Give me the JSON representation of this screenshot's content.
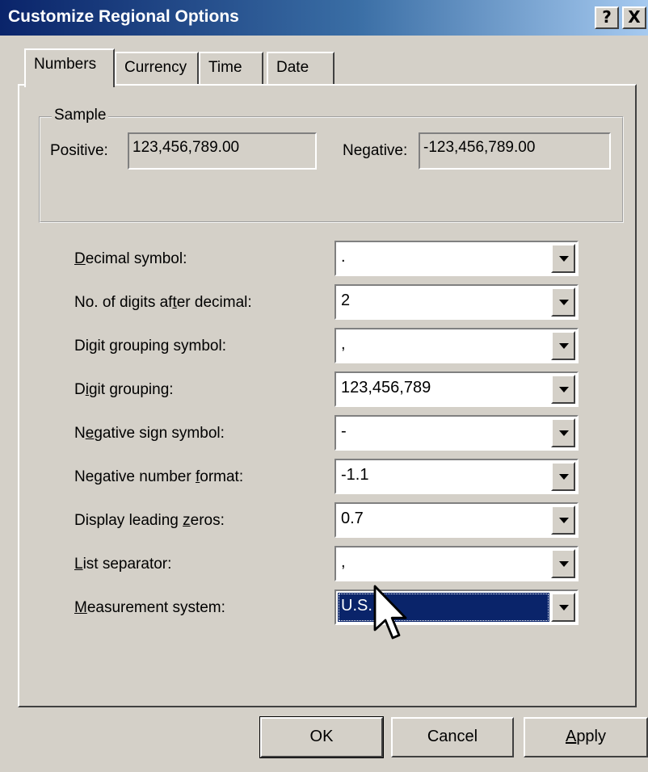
{
  "window": {
    "title": "Customize Regional Options",
    "help_button": "?",
    "close_button": "X"
  },
  "tabs": [
    {
      "label": "Numbers",
      "active": true
    },
    {
      "label": "Currency",
      "active": false
    },
    {
      "label": "Time",
      "active": false
    },
    {
      "label": "Date",
      "active": false
    }
  ],
  "sample": {
    "group_label": "Sample",
    "positive_label": "Positive:",
    "positive_value": "123,456,789.00",
    "negative_label": "Negative:",
    "negative_value": "-123,456,789.00"
  },
  "settings": [
    {
      "label": "Decimal symbol:",
      "value": "."
    },
    {
      "label": "No. of digits after decimal:",
      "value": "2"
    },
    {
      "label": "Digit grouping symbol:",
      "value": ","
    },
    {
      "label": "Digit grouping:",
      "value": "123,456,789"
    },
    {
      "label": "Negative sign symbol:",
      "value": "-"
    },
    {
      "label": "Negative number format:",
      "value": "-1.1"
    },
    {
      "label": "Display leading zeros:",
      "value": "0.7"
    },
    {
      "label": "List separator:",
      "value": ","
    },
    {
      "label": "Measurement system:",
      "value": "U.S."
    }
  ],
  "buttons": {
    "ok": "OK",
    "cancel": "Cancel",
    "apply": "Apply"
  },
  "colors": {
    "titlebar_start": "#0a246a",
    "titlebar_end": "#a6caf0",
    "face": "#d4d0c8",
    "selection": "#0a246a"
  }
}
